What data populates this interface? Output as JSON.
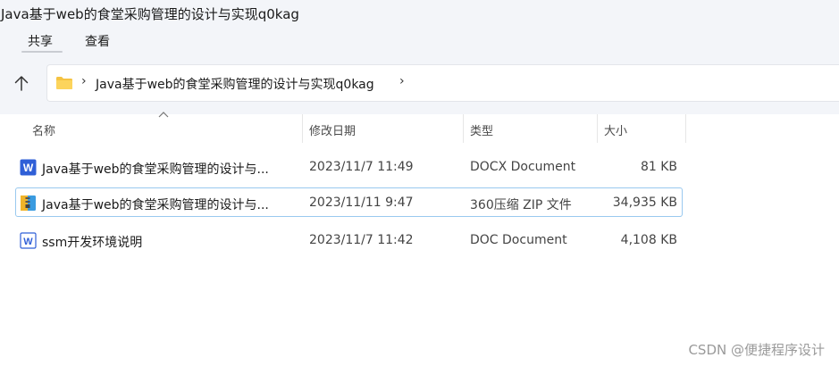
{
  "window": {
    "title": "Java基于web的食堂采购管理的设计与实现q0kag"
  },
  "menu": {
    "share": "共享",
    "view": "查看"
  },
  "address": {
    "crumb": "Java基于web的食堂采购管理的设计与实现q0kag"
  },
  "columns": {
    "name": "名称",
    "date": "修改日期",
    "type": "类型",
    "size": "大小"
  },
  "files": [
    {
      "name": "Java基于web的食堂采购管理的设计与...",
      "date": "2023/11/7 11:49",
      "type": "DOCX Document",
      "size": "81 KB",
      "icon": "word-docx-icon"
    },
    {
      "name": "Java基于web的食堂采购管理的设计与...",
      "date": "2023/11/11 9:47",
      "type": "360压缩 ZIP 文件",
      "size": "34,935 KB",
      "icon": "zip-archive-icon"
    },
    {
      "name": "ssm开发环境说明",
      "date": "2023/11/7 11:42",
      "type": "DOC Document",
      "size": "4,108 KB",
      "icon": "word-doc-icon"
    }
  ],
  "watermark": "CSDN @便捷程序设计",
  "colors": {
    "header_bg": "#f3f5f9",
    "selection_border": "#99c9ef",
    "word_blue": "#2f5fd7",
    "folder_yellow": "#f5c342"
  }
}
